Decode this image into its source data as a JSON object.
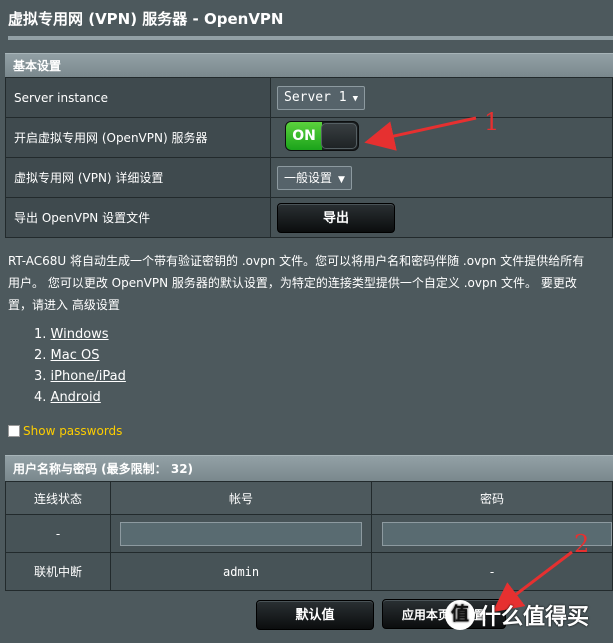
{
  "header": {
    "title": "虚拟专用网 (VPN) 服务器 - OpenVPN"
  },
  "basic": {
    "section_title": "基本设置",
    "server_instance_label": "Server instance",
    "server_instance_value": "Server 1",
    "enable_label": "开启虚拟专用网 (OpenVPN) 服务器",
    "enable_state": "ON",
    "details_label": "虚拟专用网 (VPN) 详细设置",
    "details_value": "一般设置",
    "export_label": "导出 OpenVPN 设置文件",
    "export_button": "导出"
  },
  "description": {
    "line1": "RT-AC68U 将自动生成一个带有验证密钥的 .ovpn 文件。您可以将用户名和密码伴随 .ovpn 文件提供给所有",
    "line2": "用户。 您可以更改 OpenVPN 服务器的默认设置，为特定的连接类型提供一个自定义 .ovpn 文件。 要更改",
    "line3": "置，请进入 高级设置"
  },
  "os_links": [
    {
      "num": "1.",
      "label": "Windows"
    },
    {
      "num": "2.",
      "label": "Mac OS"
    },
    {
      "num": "3.",
      "label": "iPhone/iPad"
    },
    {
      "num": "4.",
      "label": "Android"
    }
  ],
  "show_passwords": "Show passwords",
  "users": {
    "section_title": "用户名称与密码 (最多限制： 32)",
    "columns": [
      "连线状态",
      "帐号",
      "密码"
    ],
    "add_row_status": "-",
    "rows": [
      {
        "status": "联机中断",
        "username": "admin",
        "password": "-"
      }
    ]
  },
  "footer": {
    "default_button": "默认值",
    "apply_button": "应用本页面设置"
  },
  "annotations": {
    "one": "1",
    "two": "2"
  },
  "watermark": {
    "logo": "值",
    "text": "什么值得买"
  },
  "colors": {
    "background": "#4d595d",
    "toggle_on": "#1ba31b",
    "link_accent": "#fdcd00",
    "arrow": "#e63030"
  }
}
